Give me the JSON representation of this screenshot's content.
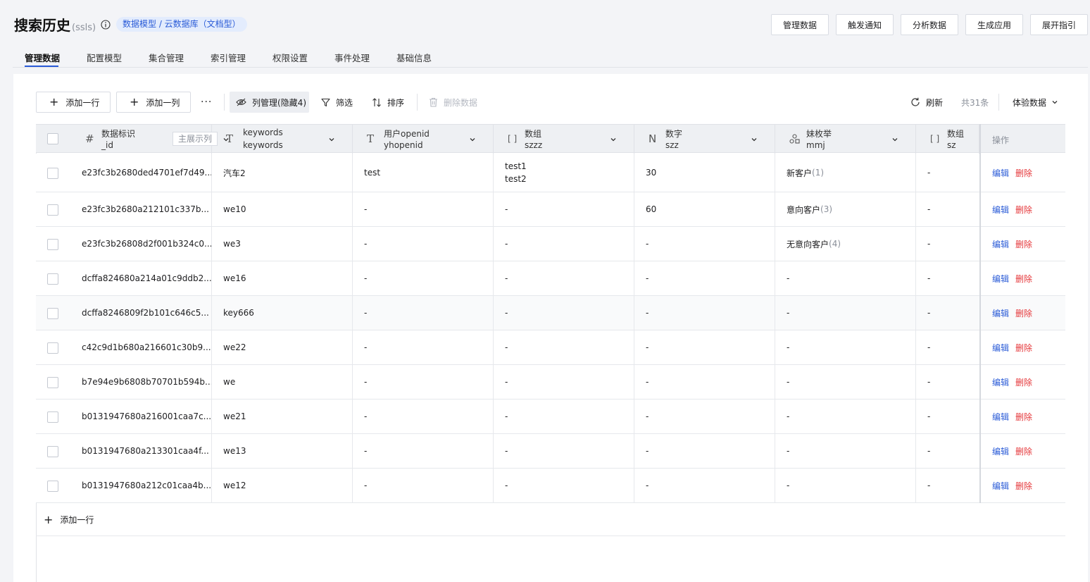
{
  "header": {
    "title": "搜索历史",
    "subtitle": "(ssls)",
    "tag": "数据模型 / 云数据库（文档型）",
    "buttons": [
      "管理数据",
      "触发通知",
      "分析数据",
      "生成应用",
      "展开指引"
    ]
  },
  "tabs": [
    "管理数据",
    "配置模型",
    "集合管理",
    "索引管理",
    "权限设置",
    "事件处理",
    "基础信息"
  ],
  "toolbar": {
    "add_row": "添加一行",
    "add_col": "添加一列",
    "more": "···",
    "col_manage": "列管理(隐藏4)",
    "filter": "筛选",
    "sort": "排序",
    "delete": "删除数据",
    "refresh": "刷新",
    "count": "共31条",
    "env": "体验数据"
  },
  "columns": [
    {
      "icon": "#",
      "name": "数据标识",
      "field": "_id",
      "pk": "主展示列"
    },
    {
      "icon": "T",
      "name": "keywords",
      "field": "keywords"
    },
    {
      "icon": "T",
      "name": "用户openid",
      "field": "yhopenid"
    },
    {
      "icon": "[ ]",
      "name": "数组",
      "field": "szzz"
    },
    {
      "icon": "N",
      "name": "数字",
      "field": "szz"
    },
    {
      "icon": "enum",
      "name": "妹枚举",
      "field": "mmj"
    },
    {
      "icon": "[ ]",
      "name": "数组",
      "field": "sz"
    }
  ],
  "actions_header": "操作",
  "edit_label": "编辑",
  "delete_label": "删除",
  "rows": [
    {
      "id": "e23fc3b2680ded4701ef7d49...",
      "kw": "汽车2",
      "openid": "test",
      "arr": [
        "test1",
        "test2"
      ],
      "num": "30",
      "enum": "新客户",
      "enum_n": "(1)",
      "sz": "-"
    },
    {
      "id": "e23fc3b2680a212101c337b...",
      "kw": "we10",
      "openid": "-",
      "arr": [
        "-"
      ],
      "num": "60",
      "enum": "意向客户",
      "enum_n": "(3)",
      "sz": "-"
    },
    {
      "id": "e23fc3b26808d2f001b324c0...",
      "kw": "we3",
      "openid": "-",
      "arr": [
        "-"
      ],
      "num": "-",
      "enum": "无意向客户",
      "enum_n": "(4)",
      "sz": "-"
    },
    {
      "id": "dcffa824680a214a01c9ddb2...",
      "kw": "we16",
      "openid": "-",
      "arr": [
        "-"
      ],
      "num": "-",
      "enum": "-",
      "enum_n": "",
      "sz": "-"
    },
    {
      "id": "dcffa8246809f2b101c646c5...",
      "kw": "key666",
      "openid": "-",
      "arr": [
        "-"
      ],
      "num": "-",
      "enum": "-",
      "enum_n": "",
      "sz": "-"
    },
    {
      "id": "c42c9d1b680a216601c30b9...",
      "kw": "we22",
      "openid": "-",
      "arr": [
        "-"
      ],
      "num": "-",
      "enum": "-",
      "enum_n": "",
      "sz": "-"
    },
    {
      "id": "b7e94e9b6808b70701b594b...",
      "kw": "we",
      "openid": "-",
      "arr": [
        "-"
      ],
      "num": "-",
      "enum": "-",
      "enum_n": "",
      "sz": "-"
    },
    {
      "id": "b0131947680a216001caa7c...",
      "kw": "we21",
      "openid": "-",
      "arr": [
        "-"
      ],
      "num": "-",
      "enum": "-",
      "enum_n": "",
      "sz": "-"
    },
    {
      "id": "b0131947680a213301caa4f...",
      "kw": "we13",
      "openid": "-",
      "arr": [
        "-"
      ],
      "num": "-",
      "enum": "-",
      "enum_n": "",
      "sz": "-"
    },
    {
      "id": "b0131947680a212c01caa4b...",
      "kw": "we12",
      "openid": "-",
      "arr": [
        "-"
      ],
      "num": "-",
      "enum": "-",
      "enum_n": "",
      "sz": "-"
    }
  ],
  "footer_add_row": "添加一行"
}
